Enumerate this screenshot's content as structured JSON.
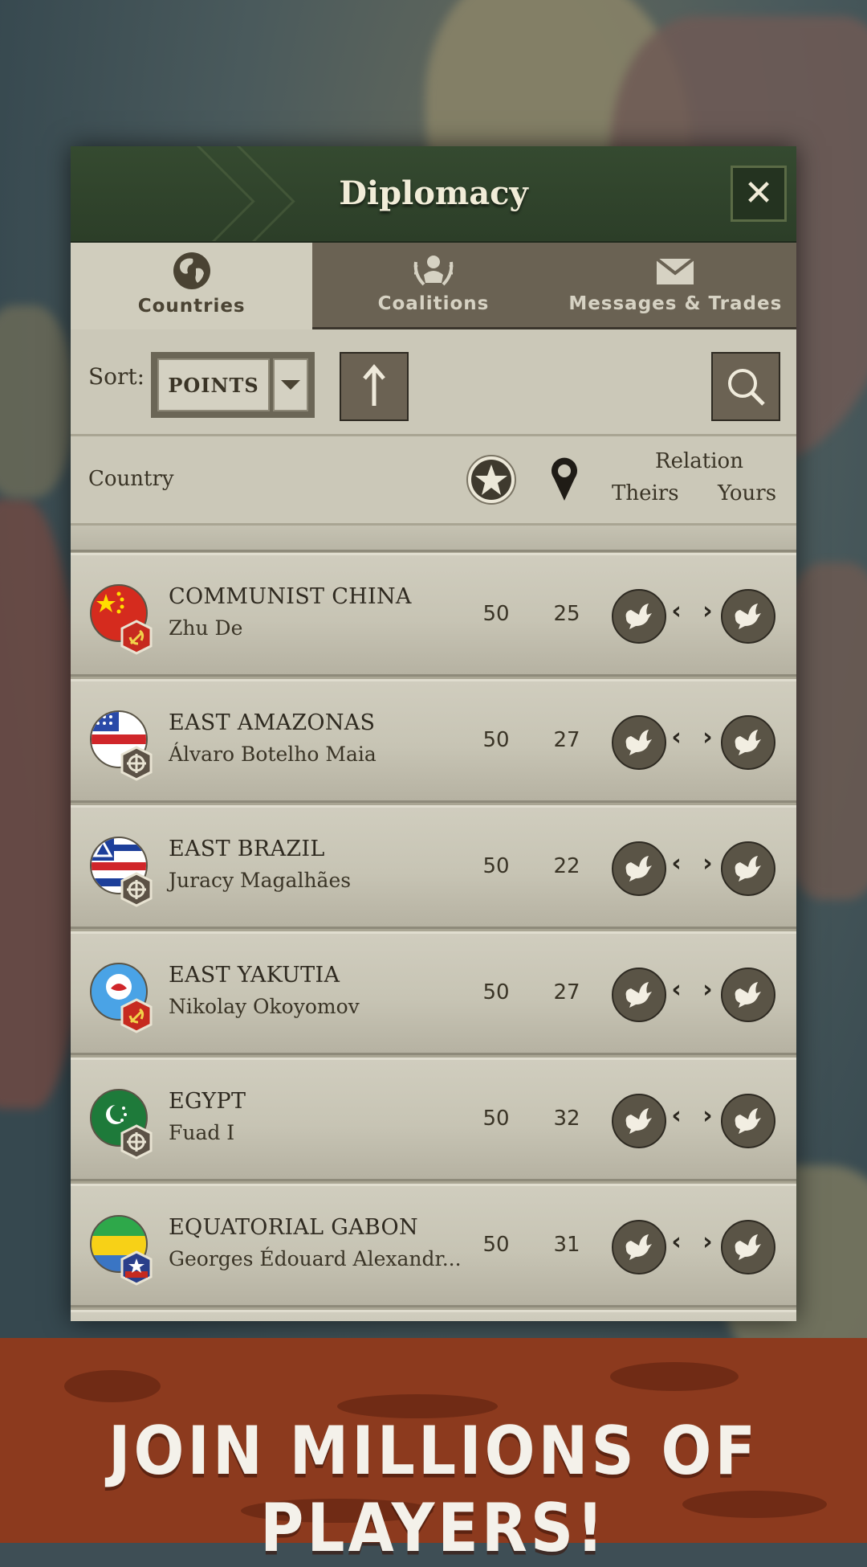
{
  "dialog": {
    "title": "Diplomacy",
    "close_label": "✕"
  },
  "tabs": [
    {
      "label": "Countries",
      "icon": "globe-icon",
      "active": true
    },
    {
      "label": "Coalitions",
      "icon": "coalition-emblem-icon",
      "active": false
    },
    {
      "label": "Messages & Trades",
      "icon": "envelope-icon",
      "active": false
    }
  ],
  "sort": {
    "label": "Sort:",
    "value": "POINTS",
    "order": "ascending"
  },
  "columns": {
    "country": "Country",
    "points_icon": "star-icon",
    "provinces_icon": "map-pin-icon",
    "relation": "Relation",
    "theirs": "Theirs",
    "yours": "Yours"
  },
  "rows": [
    {
      "country": "COMMUNIST CHINA",
      "leader": "Zhu De",
      "points": "50",
      "provinces": "25",
      "flag": "china-flag",
      "ideology": "communist-badge"
    },
    {
      "country": "EAST AMAZONAS",
      "leader": "Álvaro Botelho Maia",
      "points": "50",
      "provinces": "27",
      "flag": "amazonas-flag",
      "ideology": "fascist-badge"
    },
    {
      "country": "EAST BRAZIL",
      "leader": "Juracy Magalhães",
      "points": "50",
      "provinces": "22",
      "flag": "bahia-flag",
      "ideology": "fascist-badge"
    },
    {
      "country": "EAST YAKUTIA",
      "leader": "Nikolay Okoyomov",
      "points": "50",
      "provinces": "27",
      "flag": "yakutia-flag",
      "ideology": "communist-badge"
    },
    {
      "country": "EGYPT",
      "leader": "Fuad I",
      "points": "50",
      "provinces": "32",
      "flag": "egypt-flag",
      "ideology": "fascist-badge"
    },
    {
      "country": "EQUATORIAL GABON",
      "leader": "Georges Édouard Alexandr...",
      "points": "50",
      "provinces": "31",
      "flag": "gabon-flag",
      "ideology": "allied-badge"
    }
  ],
  "relation_arrows": "‹ ›",
  "banner": {
    "text": "JOIN MILLIONS OF PLAYERS!"
  },
  "colors": {
    "header_green": "#2f4229",
    "panel_beige": "#c9c6b6",
    "tab_dark": "#6a6253",
    "banner_red": "#8c3a1e"
  }
}
